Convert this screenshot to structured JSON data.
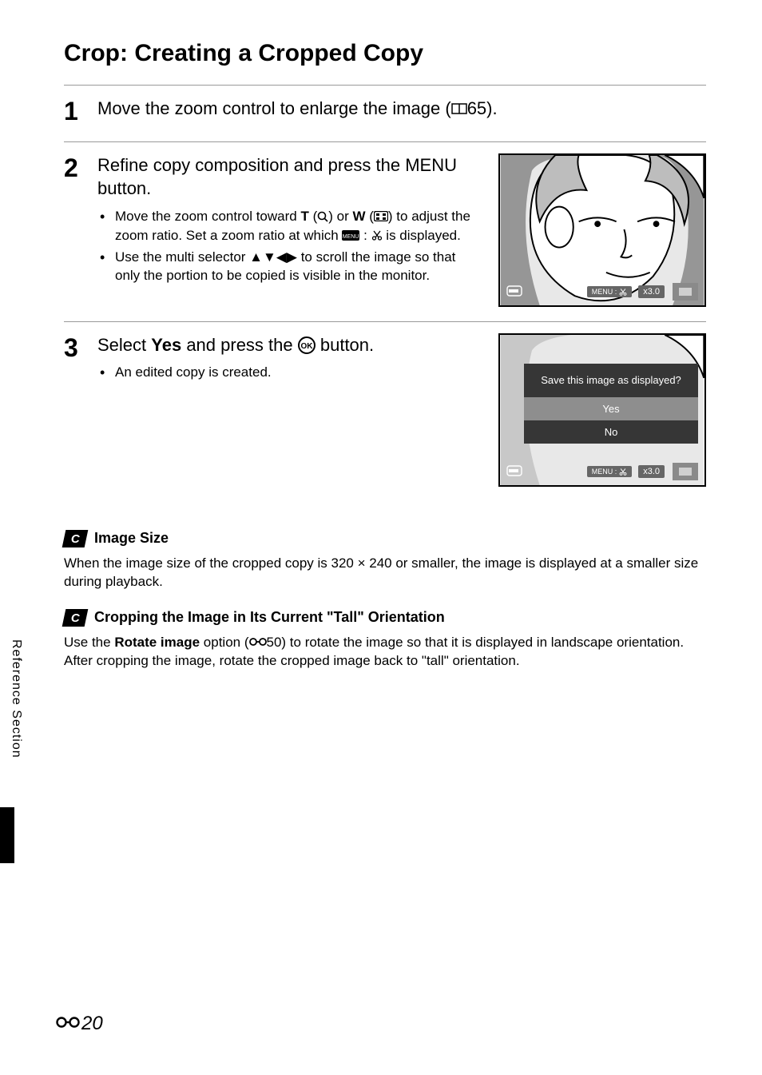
{
  "page": {
    "title": "Crop: Creating a Cropped Copy",
    "sideTab": "Reference Section",
    "pageNum": "20"
  },
  "step1": {
    "num": "1",
    "heading_pre": "Move the zoom control to enlarge the image (",
    "heading_ref": "65).",
    "heading_full": "Move the zoom control to enlarge the image ( 65)."
  },
  "step2": {
    "num": "2",
    "heading_a": "Refine copy composition and press the ",
    "heading_b": " button.",
    "menuWord": "MENU",
    "bullet1_a": "Move the zoom control toward ",
    "bullet1_T": "T",
    "bullet1_b": " (",
    "bullet1_c": ") or ",
    "bullet1_W": "W",
    "bullet1_d": " (",
    "bullet1_e": ") to adjust the zoom ratio. Set a zoom ratio at which ",
    "bullet1_f": " is displayed.",
    "bullet2": "Use the multi selector ▲▼◀▶ to scroll the image so that only the portion to be copied is visible in the monitor.",
    "overlayMenu": "MENU :",
    "overlayZoom": "x3.0"
  },
  "step3": {
    "num": "3",
    "heading_a": "Select ",
    "heading_yes": "Yes",
    "heading_b": " and press the ",
    "heading_c": " button.",
    "bullet1": "An edited copy is created.",
    "dialogQ": "Save this image as displayed?",
    "optYes": "Yes",
    "optNo": "No",
    "overlayMenu": "MENU :",
    "overlayZoom": "x3.0"
  },
  "note1": {
    "title": "Image Size",
    "body": "When the image size of the cropped copy is 320 × 240 or smaller, the image is displayed at a smaller size during playback."
  },
  "note2": {
    "title": "Cropping the Image in Its Current \"Tall\" Orientation",
    "body_a": "Use the ",
    "body_bold": "Rotate image",
    "body_b": " option (",
    "body_ref": "50) to rotate the image so that it is displayed in landscape orientation. After cropping the image, rotate the cropped image back to \"tall\" orientation."
  }
}
